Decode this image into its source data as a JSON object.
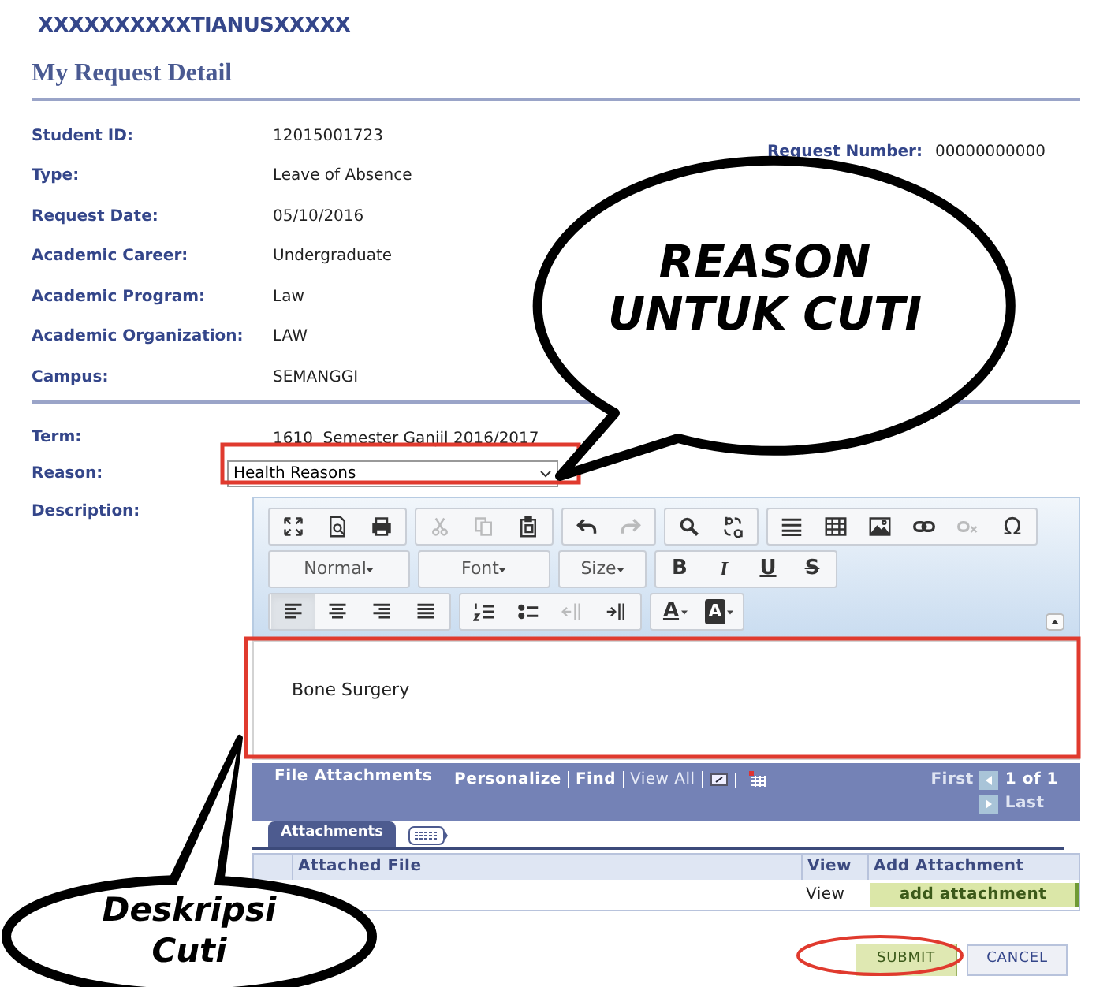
{
  "header": {
    "user": "XXXXXXXXXXTIANUSXXXXX",
    "title": "My Request Detail"
  },
  "fields": [
    {
      "label": "Student ID:",
      "value": "12015001723"
    },
    {
      "label": "Type:",
      "value": "Leave of Absence"
    },
    {
      "label": "Request Date:",
      "value": "05/10/2016"
    },
    {
      "label": "Academic Career:",
      "value": "Undergraduate"
    },
    {
      "label": "Academic Program:",
      "value": "Law"
    },
    {
      "label": "Academic Organization:",
      "value": "LAW"
    },
    {
      "label": "Campus:",
      "value": "SEMANGGI"
    }
  ],
  "request_number": {
    "label": "Request Number:",
    "value": "00000000000"
  },
  "term": {
    "label": "Term:",
    "value": "1610  Semester Ganjil 2016/2017"
  },
  "reason": {
    "label": "Reason:",
    "value": "Health Reasons"
  },
  "description": {
    "label": "Description:",
    "text": "Bone Surgery"
  },
  "editor": {
    "toolbar": [
      {
        "groups": [
          {
            "buttons": [
              {
                "kind": "maximize",
                "disabled": false,
                "selected": false
              },
              {
                "kind": "preview",
                "disabled": false,
                "selected": false
              },
              {
                "kind": "print",
                "disabled": false,
                "selected": false
              }
            ]
          },
          {
            "buttons": [
              {
                "kind": "cut",
                "disabled": true,
                "selected": false
              },
              {
                "kind": "copy",
                "disabled": true,
                "selected": false
              },
              {
                "kind": "paste",
                "disabled": false,
                "selected": false
              }
            ]
          },
          {
            "buttons": [
              {
                "kind": "undo",
                "disabled": false,
                "selected": false
              },
              {
                "kind": "redo",
                "disabled": true,
                "selected": false
              }
            ]
          },
          {
            "buttons": [
              {
                "kind": "find",
                "disabled": false,
                "selected": false
              },
              {
                "kind": "replace",
                "disabled": false,
                "selected": false
              }
            ]
          },
          {
            "buttons": [
              {
                "kind": "rule",
                "disabled": false,
                "selected": false
              },
              {
                "kind": "table",
                "disabled": false,
                "selected": false
              },
              {
                "kind": "image",
                "disabled": false,
                "selected": false
              },
              {
                "kind": "link",
                "disabled": false,
                "selected": false
              },
              {
                "kind": "unlink",
                "disabled": true,
                "selected": false
              },
              {
                "kind": "char",
                "text": "Ω",
                "disabled": false,
                "selected": false
              }
            ]
          }
        ]
      },
      {
        "groups": [
          {
            "buttons": [
              {
                "kind": "combo",
                "text": "Normal",
                "disabled": false,
                "selected": false
              }
            ]
          },
          {
            "buttons": [
              {
                "kind": "combo",
                "text": "Font",
                "disabled": false,
                "selected": false
              }
            ]
          },
          {
            "buttons": [
              {
                "kind": "combo",
                "text": "Size",
                "disabled": false,
                "selected": false
              }
            ]
          },
          {
            "buttons": [
              {
                "kind": "bold",
                "text": "B",
                "disabled": false,
                "selected": false
              },
              {
                "kind": "italic",
                "text": "I",
                "disabled": false,
                "selected": false
              },
              {
                "kind": "underline",
                "text": "U",
                "disabled": false,
                "selected": false
              },
              {
                "kind": "strike",
                "text": "S",
                "disabled": false,
                "selected": false
              }
            ]
          }
        ]
      },
      {
        "groups": [
          {
            "buttons": [
              {
                "kind": "align-left",
                "disabled": false,
                "selected": true
              },
              {
                "kind": "align-center",
                "disabled": false,
                "selected": false
              },
              {
                "kind": "align-right",
                "disabled": false,
                "selected": false
              },
              {
                "kind": "justify",
                "disabled": false,
                "selected": false
              }
            ]
          },
          {
            "buttons": [
              {
                "kind": "numbered-list",
                "disabled": false,
                "selected": false
              },
              {
                "kind": "bullet-list",
                "disabled": false,
                "selected": false
              },
              {
                "kind": "outdent",
                "disabled": true,
                "selected": false
              },
              {
                "kind": "indent",
                "disabled": false,
                "selected": false
              }
            ]
          },
          {
            "buttons": [
              {
                "kind": "text-color",
                "text": "A",
                "disabled": false,
                "selected": false
              },
              {
                "kind": "back-color",
                "text": "A",
                "disabled": false,
                "selected": false
              }
            ]
          }
        ]
      }
    ]
  },
  "attachments": {
    "title": "File Attachments",
    "links": [
      "Personalize",
      "Find",
      "View All"
    ],
    "pager": {
      "first": "First",
      "count": "1 of 1",
      "last": "Last"
    },
    "tabs": [
      {
        "label": "Attachments",
        "selected": true
      }
    ],
    "columns": [
      "Attached File",
      "View",
      "Add Attachment"
    ],
    "rows": [
      {
        "view": "View",
        "action": "add attachment"
      }
    ]
  },
  "buttons": [
    {
      "label": "SUBMIT",
      "kind": "primary"
    },
    {
      "label": "CANCEL",
      "kind": "secondary"
    }
  ],
  "callouts": [
    {
      "lines": [
        "REASON",
        "UNTUK CUTI"
      ]
    },
    {
      "lines": [
        "Deskripsi",
        "Cuti"
      ]
    }
  ]
}
